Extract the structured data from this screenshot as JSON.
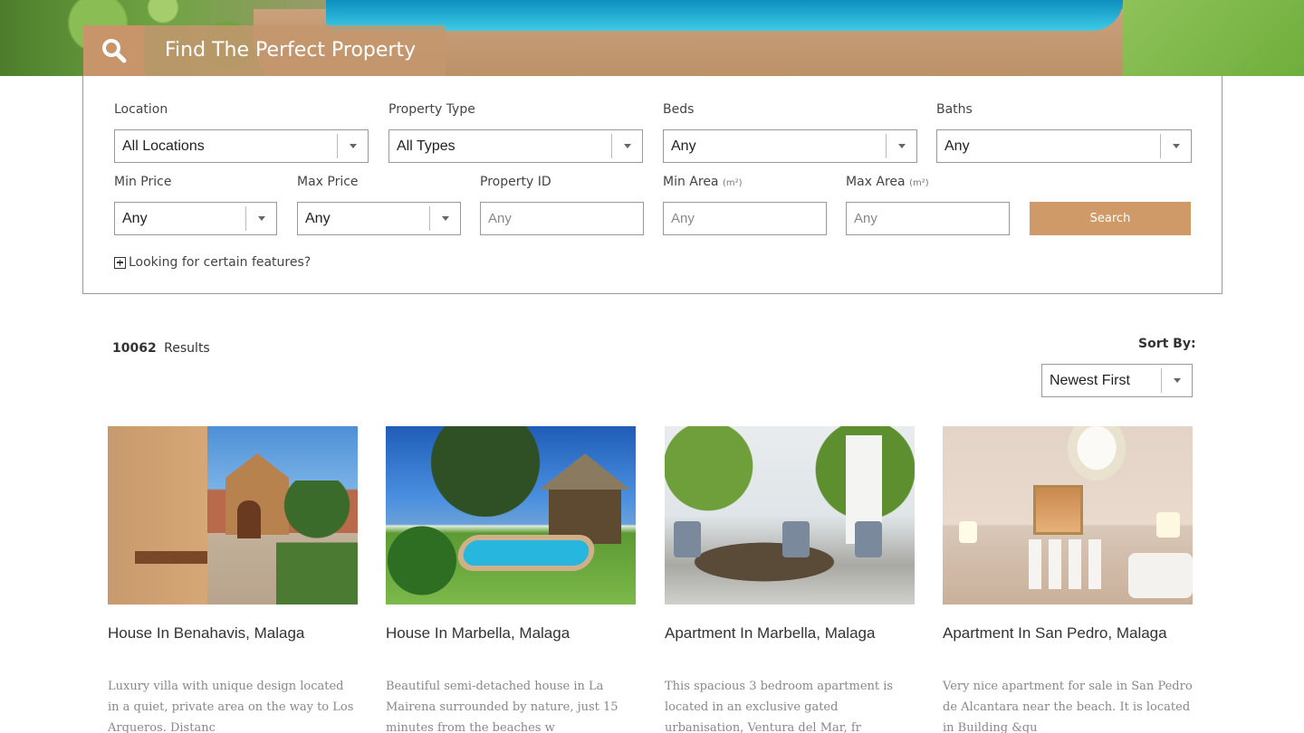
{
  "hero": {
    "title": "Find The Perfect Property",
    "accent_color": "#c8946a"
  },
  "search": {
    "location": {
      "label": "Location",
      "value": "All Locations"
    },
    "property_type": {
      "label": "Property Type",
      "value": "All Types"
    },
    "beds": {
      "label": "Beds",
      "value": "Any"
    },
    "baths": {
      "label": "Baths",
      "value": "Any"
    },
    "min_price": {
      "label": "Min Price",
      "value": "Any"
    },
    "max_price": {
      "label": "Max Price",
      "value": "Any"
    },
    "property_id": {
      "label": "Property ID",
      "placeholder": "Any"
    },
    "min_area": {
      "label": "Min Area",
      "unit": "(m²)",
      "placeholder": "Any"
    },
    "max_area": {
      "label": "Max Area",
      "unit": "(m²)",
      "placeholder": "Any"
    },
    "search_button": "Search",
    "features_link": "Looking for certain features?",
    "button_color": "#d09a68"
  },
  "results": {
    "count": "10062",
    "count_label": "Results",
    "sort_label": "Sort By:",
    "sort_value": "Newest First"
  },
  "listings": [
    {
      "title": "House In Benahavis, Malaga",
      "desc": "Luxury villa with unique design located in a quiet, private area on the way to Los Arqueros. Distanc"
    },
    {
      "title": "House In Marbella, Malaga",
      "desc": "Beautiful semi-detached house in La Mairena surrounded by nature, just 15 minutes from the beaches w"
    },
    {
      "title": "Apartment In Marbella, Malaga",
      "desc": "This spacious 3 bedroom apartment is located in an exclusive gated urbanisation, Ventura del Mar, fr"
    },
    {
      "title": "Apartment In San Pedro, Malaga",
      "desc": "Very nice apartment for sale in San Pedro de Alcantara near the beach. It is located in Building &qu"
    }
  ]
}
